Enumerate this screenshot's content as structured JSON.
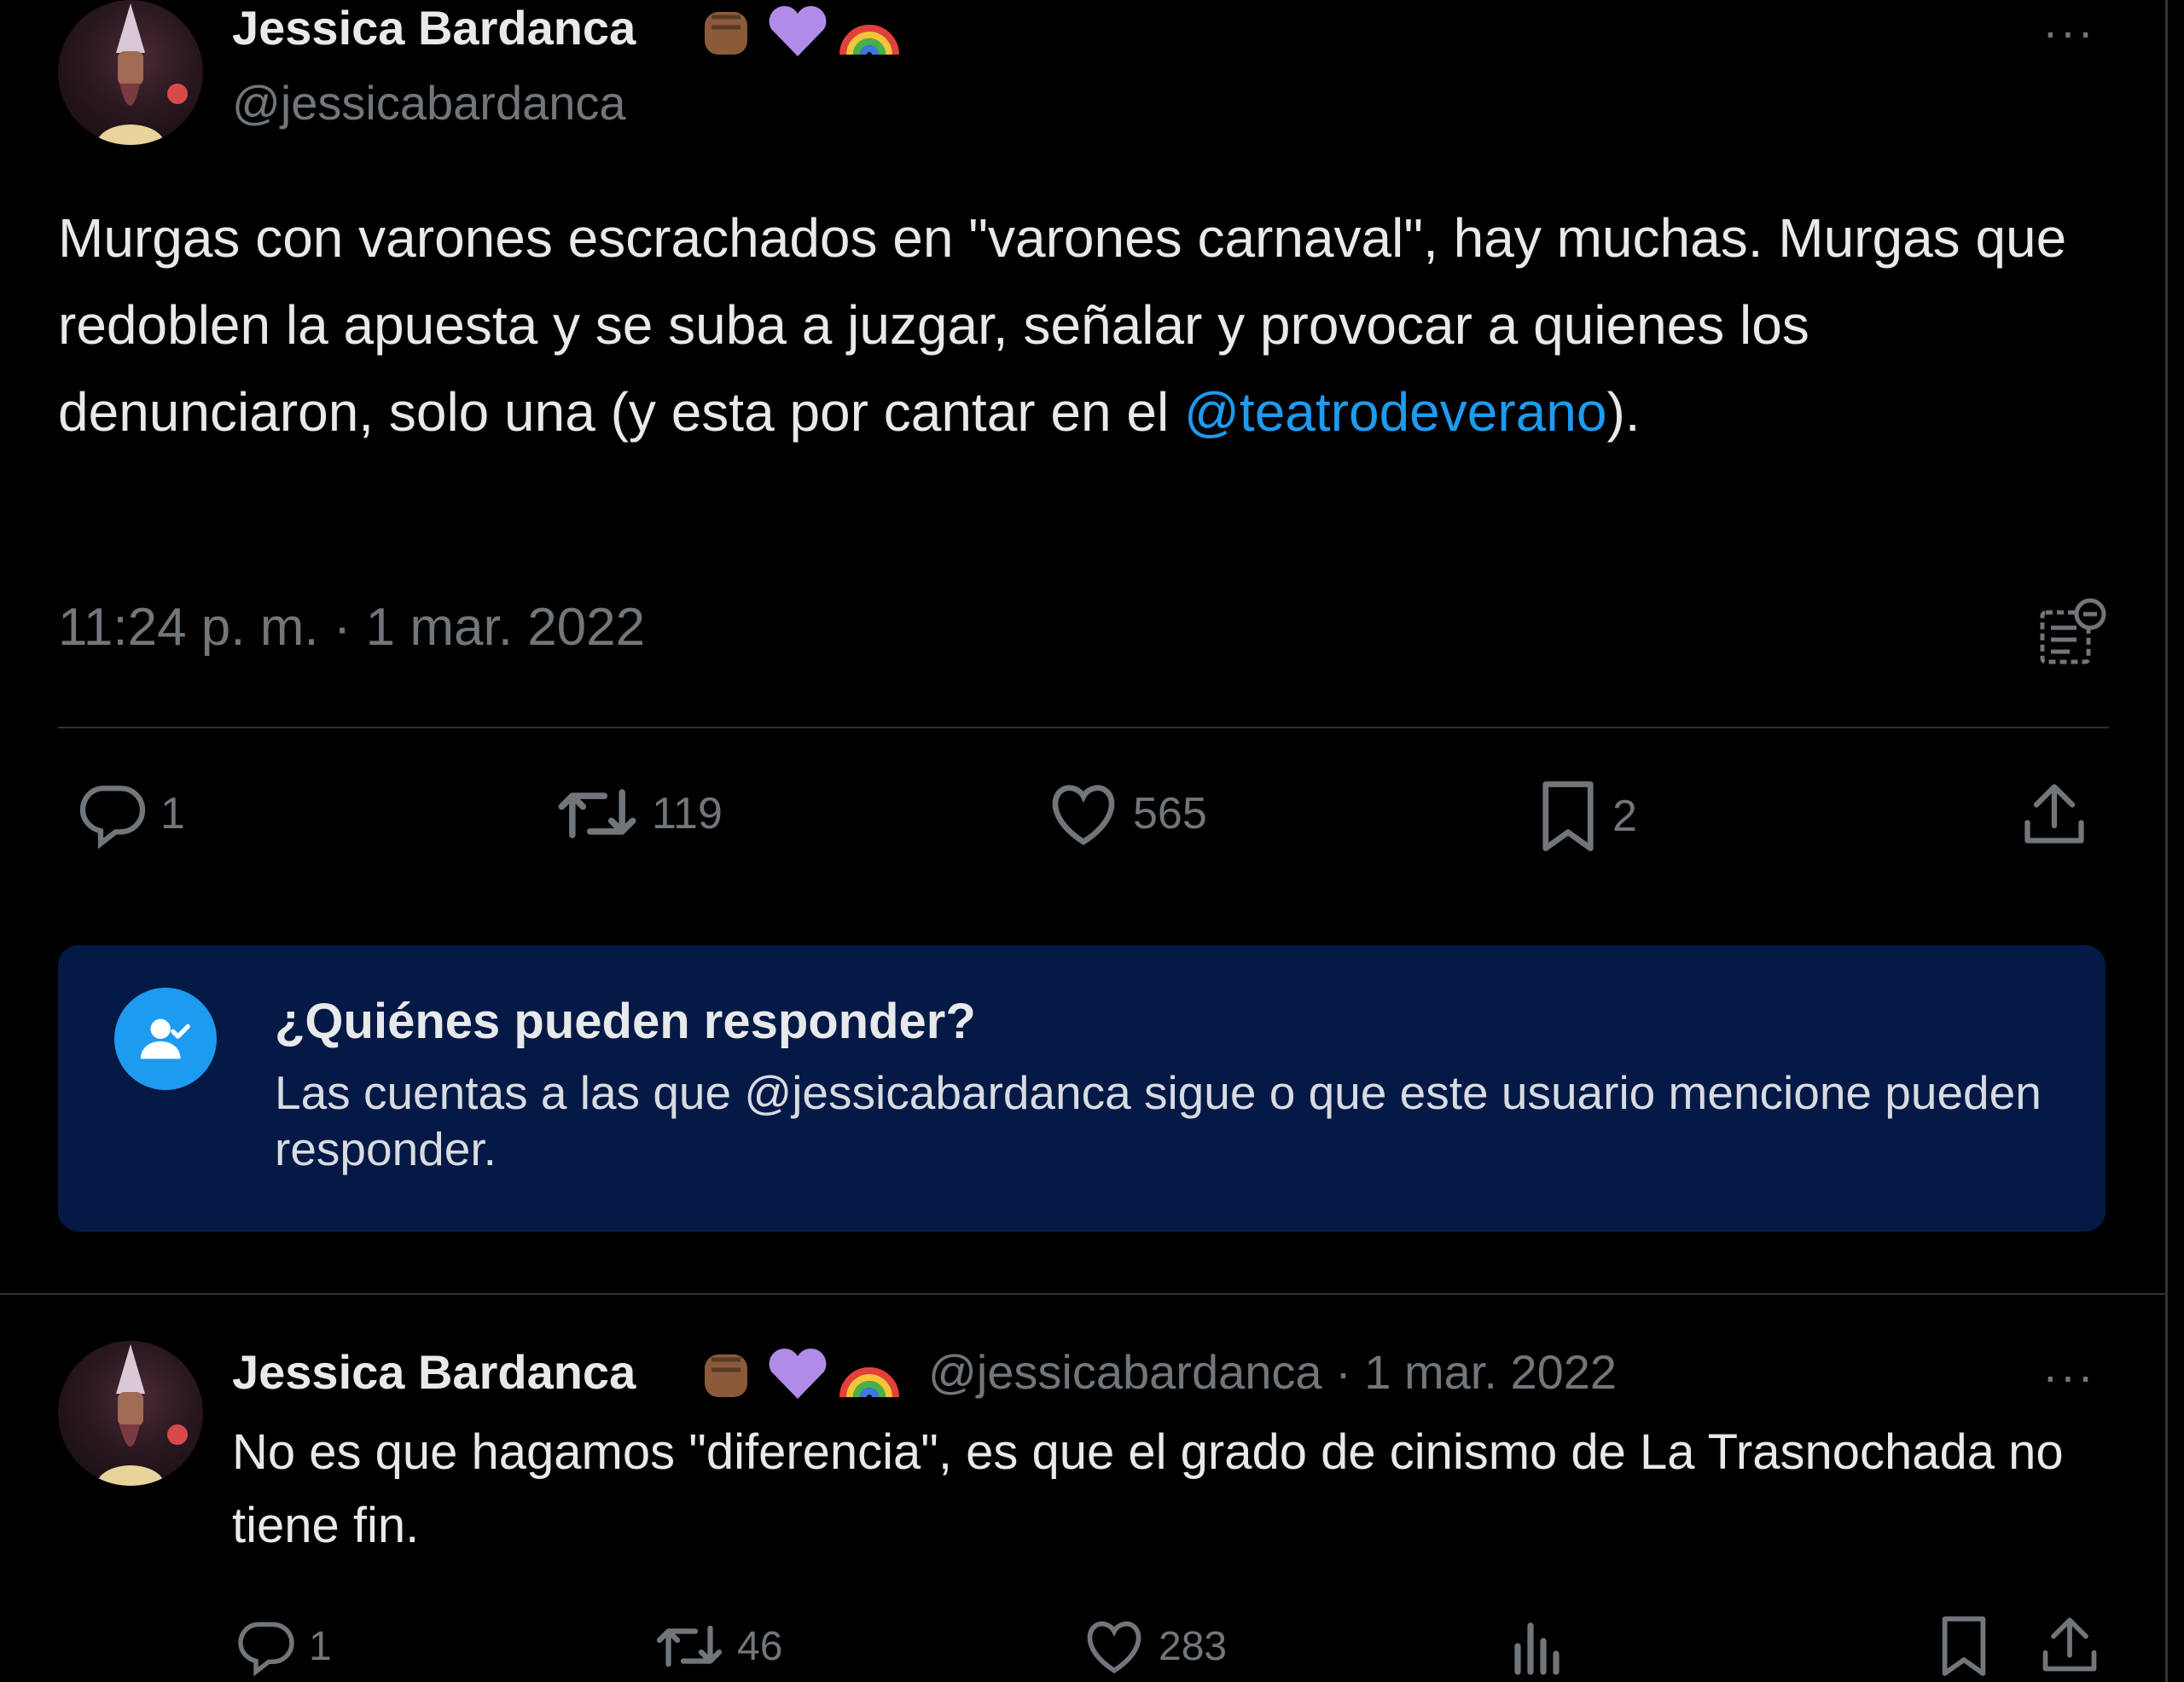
{
  "main_tweet": {
    "author_name": "Jessica Bardanca",
    "author_handle": "@jessicabardanca",
    "name_emojis": [
      "raised-fist-medium-dark-icon",
      "purple-heart-icon",
      "rainbow-icon"
    ],
    "text_before_mention": "Murgas con varones escrachados en \"varones carnaval\", hay muchas. Murgas que redoblen la apuesta y se suba a juzgar, señalar y provocar a quienes los denunciaron, solo una (y esta por cantar en el ",
    "mention": "@teatrodeverano",
    "text_after_mention": ").",
    "timestamp": "11:24 p. m. · 1 mar. 2022",
    "actions": {
      "replies": "1",
      "retweets": "119",
      "likes": "565",
      "bookmarks": "2"
    }
  },
  "reply_restriction": {
    "title": "¿Quiénes pueden responder?",
    "description": "Las cuentas a las que @jessicabardanca sigue o que este usuario mencione pueden responder."
  },
  "reply_tweet": {
    "author_name": "Jessica Bardanca",
    "handle_date": "@jessicabardanca · 1 mar. 2022",
    "text": "No es que hagamos \"diferencia\", es que el grado de cinismo de La Trasnochada no tiene fin.",
    "actions": {
      "replies": "1",
      "retweets": "46",
      "likes": "283"
    }
  },
  "more_glyph": "···",
  "colors": {
    "background": "#000000",
    "text_primary": "#e7e9ea",
    "text_secondary": "#71767b",
    "accent": "#1d9bf0",
    "card_background": "#051946",
    "border": "#2f3336"
  }
}
